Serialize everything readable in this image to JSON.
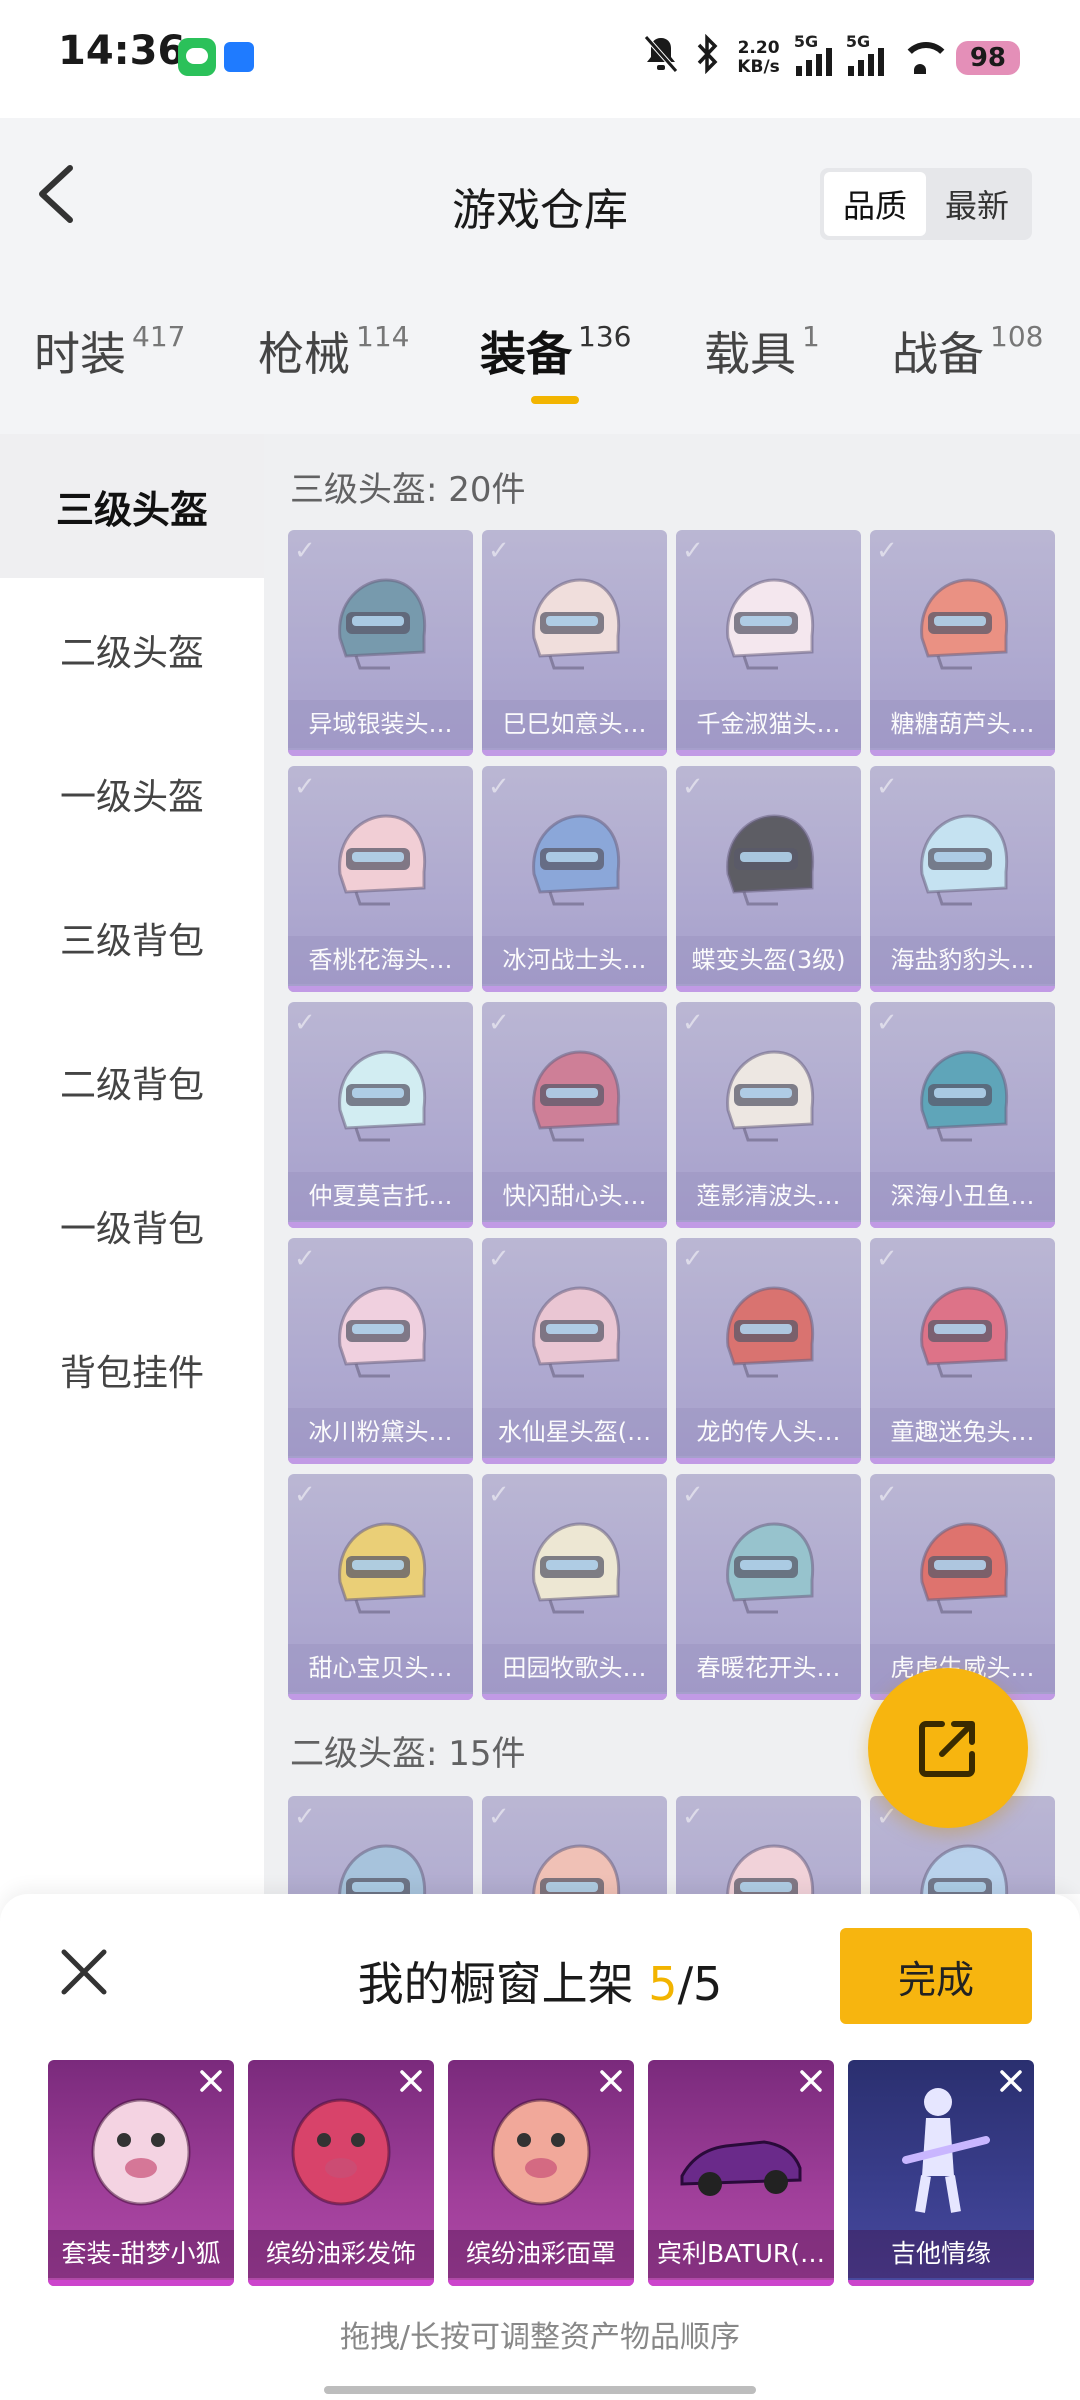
{
  "status": {
    "time": "14:36",
    "speed_value": "2.20",
    "speed_unit": "KB/s",
    "signal1_label": "5G",
    "signal2_label": "5G",
    "battery": "98"
  },
  "header": {
    "title": "游戏仓库",
    "sort_options": [
      "品质",
      "最新"
    ]
  },
  "tabs": [
    {
      "label": "时装",
      "count": "417"
    },
    {
      "label": "枪械",
      "count": "114"
    },
    {
      "label": "装备",
      "count": "136"
    },
    {
      "label": "载具",
      "count": "1"
    },
    {
      "label": "战备",
      "count": "108"
    }
  ],
  "sidebar": {
    "items": [
      "三级头盔",
      "二级头盔",
      "一级头盔",
      "三级背包",
      "二级背包",
      "一级背包",
      "背包挂件"
    ]
  },
  "sections": [
    {
      "title": "三级头盔: 20件",
      "items": [
        {
          "name": "异域银装头…",
          "color": "#4f7e96"
        },
        {
          "name": "巳巳如意头…",
          "color": "#f1d8d4"
        },
        {
          "name": "千金淑猫头…",
          "color": "#f6e4ec"
        },
        {
          "name": "糖糖葫芦头…",
          "color": "#e8725e"
        },
        {
          "name": "香桃花海头…",
          "color": "#f2c3cb"
        },
        {
          "name": "冰河战士头…",
          "color": "#6a8fd0"
        },
        {
          "name": "蝶变头盔(3级)",
          "color": "#2d2d35"
        },
        {
          "name": "海盐豹豹头…",
          "color": "#b7def0"
        },
        {
          "name": "仲夏莫吉托…",
          "color": "#c9ecf2"
        },
        {
          "name": "快闪甜心头…",
          "color": "#c35a78"
        },
        {
          "name": "莲影清波头…",
          "color": "#ece4dc"
        },
        {
          "name": "深海小丑鱼…",
          "color": "#2f8da6"
        },
        {
          "name": "冰川粉黛头…",
          "color": "#f0c6d8"
        },
        {
          "name": "水仙星头盔(…",
          "color": "#e9b9c8"
        },
        {
          "name": "龙的传人头…",
          "color": "#d24a45"
        },
        {
          "name": "童趣迷兔头…",
          "color": "#d74a64"
        },
        {
          "name": "甜心宝贝头…",
          "color": "#e9c44e"
        },
        {
          "name": "田园牧歌头…",
          "color": "#ece4c8"
        },
        {
          "name": "春暖花开头…",
          "color": "#7ab4c0"
        },
        {
          "name": "虎虎生威头…",
          "color": "#d94a42"
        }
      ]
    },
    {
      "title": "二级头盔: 15件",
      "items": [
        {
          "name": "",
          "color": "#8fb4d4"
        },
        {
          "name": "",
          "color": "#f0b2a2"
        },
        {
          "name": "",
          "color": "#f2c8d0"
        },
        {
          "name": "",
          "color": "#a7c8ea"
        }
      ]
    }
  ],
  "sheet": {
    "title_prefix": "我的橱窗上架",
    "current": "5",
    "total": "/5",
    "done_label": "完成",
    "shelf": [
      {
        "name": "套装-甜梦小狐",
        "color": "#f4d3e2"
      },
      {
        "name": "缤纷油彩发饰",
        "color": "#d8436a"
      },
      {
        "name": "缤纷油彩面罩",
        "color": "#f1a89a"
      },
      {
        "name": "宾利BATUR(…",
        "color": "#6a2a8a"
      },
      {
        "name": "吉他情缘",
        "color": "#e6e6ff"
      }
    ],
    "hint": "拖拽/长按可调整资产物品顺序"
  },
  "colors": {
    "accent": "#f7b50f",
    "card_purple": "#9a93c4",
    "shelf_magenta": "#a03f9a"
  }
}
